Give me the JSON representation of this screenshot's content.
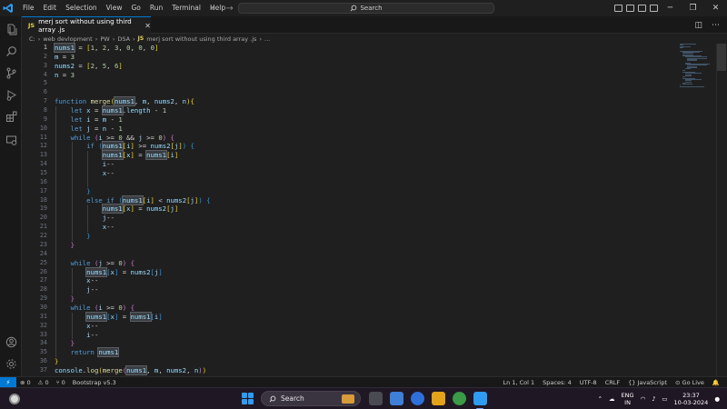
{
  "menu": [
    "File",
    "Edit",
    "Selection",
    "View",
    "Go",
    "Run",
    "Terminal",
    "Help"
  ],
  "search": {
    "label": "Search"
  },
  "tab": {
    "lang_badge": "JS",
    "title": "merj sort without using third array .js",
    "close": "✕"
  },
  "breadcrumb": {
    "path": [
      "C:",
      "web devlopment",
      "PW",
      "DSA"
    ],
    "lang_badge": "JS",
    "file": "merj sort without using third array .js",
    "tail": "..."
  },
  "code": {
    "active_line": 1,
    "highlight_word": "nums1",
    "lines": [
      "nums1 = [1, 2, 3, 0, 0, 0]",
      "m = 3",
      "nums2 = [2, 5, 6]",
      "n = 3",
      "",
      "",
      "function merge(nums1, m, nums2, n){",
      "    let x = nums1.length - 1",
      "    let i = m - 1",
      "    let j = n - 1",
      "    while (i >= 0 && j >= 0) {",
      "        if (nums1[i] >= nums2[j]) {",
      "            nums1[x] = nums1[i]",
      "            i--",
      "            x--",
      "",
      "        }",
      "        else if (nums1[i] < nums2[j]) {",
      "            nums1[x] = nums2[j]",
      "            j--",
      "            x--",
      "        }",
      "    }",
      "",
      "    while (j >= 0) {",
      "        nums1[x] = nums2[j]",
      "        x--",
      "        j--",
      "    }",
      "    while (i >= 0) {",
      "        nums1[x] = nums1[i]",
      "        x--",
      "        i--",
      "    }",
      "    return nums1",
      "}",
      "console.log(merge(nums1, m, nums2, n))"
    ]
  },
  "status": {
    "remote": "⚡",
    "problems_errors": "⊗ 0",
    "problems_warnings": "⚠ 0",
    "ports": "⑂ 0",
    "bootstrap": "Bootstrap v5.3",
    "position": "Ln 1, Col 1",
    "spaces": "Spaces: 4",
    "encoding": "UTF-8",
    "eol": "CRLF",
    "language": "{} JavaScript",
    "golive": "⊙ Go Live",
    "bell": "🔔"
  },
  "taskbar": {
    "search_label": "Search",
    "lang_top": "ENG",
    "lang_bottom": "IN",
    "time": "23:37",
    "date": "10-03-2024"
  },
  "colors": {
    "accent": "#0078d4",
    "keyword": "#569cd6",
    "function": "#dcdcaa",
    "number": "#b5cea8",
    "variable": "#9cdcfe",
    "bracket1": "#ffd700",
    "bracket2": "#da70d6",
    "bracket3": "#179fff"
  }
}
